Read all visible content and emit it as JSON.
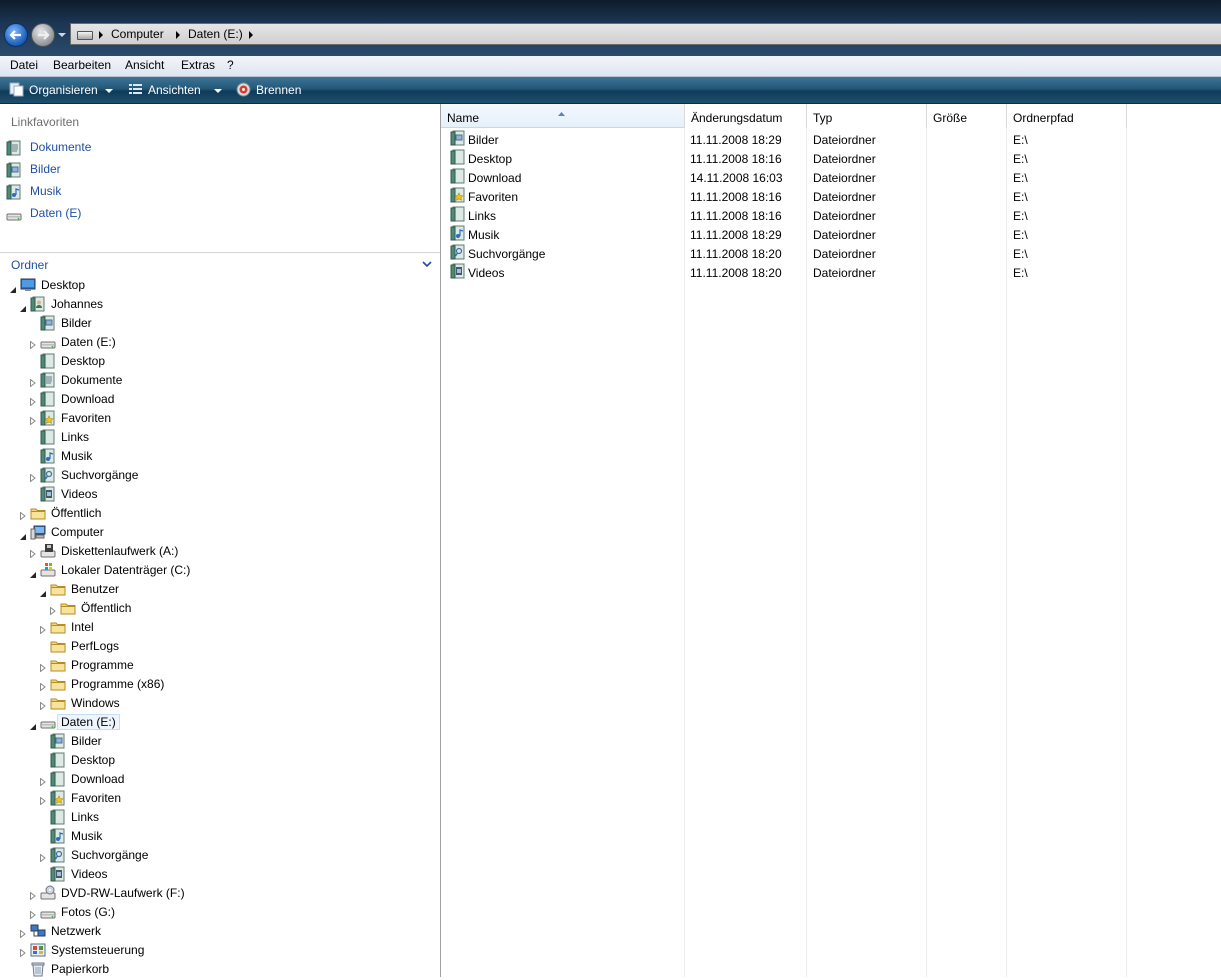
{
  "address": {
    "crumbs": [
      "Computer",
      "Daten (E:)"
    ]
  },
  "menu": [
    "Datei",
    "Bearbeiten",
    "Ansicht",
    "Extras",
    "?"
  ],
  "toolbar": {
    "organize": "Organisieren",
    "views": "Ansichten",
    "burn": "Brennen"
  },
  "favorites": {
    "heading": "Linkfavoriten",
    "items": [
      {
        "label": "Dokumente",
        "icon": "documents-folder-icon"
      },
      {
        "label": "Bilder",
        "icon": "pictures-folder-icon"
      },
      {
        "label": "Musik",
        "icon": "music-folder-icon"
      },
      {
        "label": "Daten (E)",
        "icon": "drive-icon"
      }
    ]
  },
  "folders": {
    "label": "Ordner",
    "tree": [
      {
        "label": "Desktop",
        "level": 0,
        "expander": "open",
        "icon": "desktop-icon"
      },
      {
        "label": "Johannes",
        "level": 1,
        "expander": "open",
        "icon": "user-folder-icon"
      },
      {
        "label": "Bilder",
        "level": 2,
        "expander": "none",
        "icon": "pictures-folder-icon"
      },
      {
        "label": "Daten (E:)",
        "level": 2,
        "expander": "closed",
        "icon": "drive-icon"
      },
      {
        "label": "Desktop",
        "level": 2,
        "expander": "none",
        "icon": "desktop-folder-icon"
      },
      {
        "label": "Dokumente",
        "level": 2,
        "expander": "closed",
        "icon": "documents-folder-icon"
      },
      {
        "label": "Download",
        "level": 2,
        "expander": "closed",
        "icon": "download-folder-icon"
      },
      {
        "label": "Favoriten",
        "level": 2,
        "expander": "closed",
        "icon": "favorites-folder-icon"
      },
      {
        "label": "Links",
        "level": 2,
        "expander": "none",
        "icon": "links-folder-icon"
      },
      {
        "label": "Musik",
        "level": 2,
        "expander": "none",
        "icon": "music-folder-icon"
      },
      {
        "label": "Suchvorgänge",
        "level": 2,
        "expander": "closed",
        "icon": "searches-folder-icon"
      },
      {
        "label": "Videos",
        "level": 2,
        "expander": "none",
        "icon": "videos-folder-icon"
      },
      {
        "label": "Öffentlich",
        "level": 1,
        "expander": "closed",
        "icon": "folder-icon"
      },
      {
        "label": "Computer",
        "level": 1,
        "expander": "open",
        "icon": "computer-icon"
      },
      {
        "label": "Diskettenlaufwerk (A:)",
        "level": 2,
        "expander": "closed",
        "icon": "floppy-drive-icon"
      },
      {
        "label": "Lokaler Datenträger (C:)",
        "level": 2,
        "expander": "open",
        "icon": "system-drive-icon"
      },
      {
        "label": "Benutzer",
        "level": 3,
        "expander": "open",
        "icon": "folder-icon"
      },
      {
        "label": "Öffentlich",
        "level": 4,
        "expander": "closed",
        "icon": "folder-icon"
      },
      {
        "label": "Intel",
        "level": 3,
        "expander": "closed",
        "icon": "folder-icon"
      },
      {
        "label": "PerfLogs",
        "level": 3,
        "expander": "none",
        "icon": "folder-icon"
      },
      {
        "label": "Programme",
        "level": 3,
        "expander": "closed",
        "icon": "folder-icon"
      },
      {
        "label": "Programme (x86)",
        "level": 3,
        "expander": "closed",
        "icon": "folder-icon"
      },
      {
        "label": "Windows",
        "level": 3,
        "expander": "closed",
        "icon": "folder-icon"
      },
      {
        "label": "Daten (E:)",
        "level": 2,
        "expander": "open",
        "icon": "drive-icon",
        "selected": true
      },
      {
        "label": "Bilder",
        "level": 3,
        "expander": "none",
        "icon": "pictures-folder-icon"
      },
      {
        "label": "Desktop",
        "level": 3,
        "expander": "none",
        "icon": "desktop-folder-icon"
      },
      {
        "label": "Download",
        "level": 3,
        "expander": "closed",
        "icon": "download-folder-icon"
      },
      {
        "label": "Favoriten",
        "level": 3,
        "expander": "closed",
        "icon": "favorites-folder-icon"
      },
      {
        "label": "Links",
        "level": 3,
        "expander": "none",
        "icon": "links-folder-icon"
      },
      {
        "label": "Musik",
        "level": 3,
        "expander": "none",
        "icon": "music-folder-icon"
      },
      {
        "label": "Suchvorgänge",
        "level": 3,
        "expander": "closed",
        "icon": "searches-folder-icon"
      },
      {
        "label": "Videos",
        "level": 3,
        "expander": "none",
        "icon": "videos-folder-icon"
      },
      {
        "label": "DVD-RW-Laufwerk (F:)",
        "level": 2,
        "expander": "closed",
        "icon": "dvd-drive-icon"
      },
      {
        "label": "Fotos (G:)",
        "level": 2,
        "expander": "closed",
        "icon": "drive-icon"
      },
      {
        "label": "Netzwerk",
        "level": 1,
        "expander": "closed",
        "icon": "network-icon"
      },
      {
        "label": "Systemsteuerung",
        "level": 1,
        "expander": "closed",
        "icon": "control-panel-icon"
      },
      {
        "label": "Papierkorb",
        "level": 1,
        "expander": "none",
        "icon": "recycle-bin-icon"
      }
    ]
  },
  "columns": [
    "Name",
    "Änderungsdatum",
    "Typ",
    "Größe",
    "Ordnerpfad"
  ],
  "files": [
    {
      "name": "Bilder",
      "date": "11.11.2008 18:29",
      "type": "Dateiordner",
      "size": "",
      "path": "E:\\",
      "icon": "pictures-folder-icon"
    },
    {
      "name": "Desktop",
      "date": "11.11.2008 18:16",
      "type": "Dateiordner",
      "size": "",
      "path": "E:\\",
      "icon": "desktop-folder-icon"
    },
    {
      "name": "Download",
      "date": "14.11.2008 16:03",
      "type": "Dateiordner",
      "size": "",
      "path": "E:\\",
      "icon": "download-folder-icon"
    },
    {
      "name": "Favoriten",
      "date": "11.11.2008 18:16",
      "type": "Dateiordner",
      "size": "",
      "path": "E:\\",
      "icon": "favorites-folder-icon"
    },
    {
      "name": "Links",
      "date": "11.11.2008 18:16",
      "type": "Dateiordner",
      "size": "",
      "path": "E:\\",
      "icon": "links-folder-icon"
    },
    {
      "name": "Musik",
      "date": "11.11.2008 18:29",
      "type": "Dateiordner",
      "size": "",
      "path": "E:\\",
      "icon": "music-folder-icon"
    },
    {
      "name": "Suchvorgänge",
      "date": "11.11.2008 18:20",
      "type": "Dateiordner",
      "size": "",
      "path": "E:\\",
      "icon": "searches-folder-icon"
    },
    {
      "name": "Videos",
      "date": "11.11.2008 18:20",
      "type": "Dateiordner",
      "size": "",
      "path": "E:\\",
      "icon": "videos-folder-icon"
    }
  ]
}
